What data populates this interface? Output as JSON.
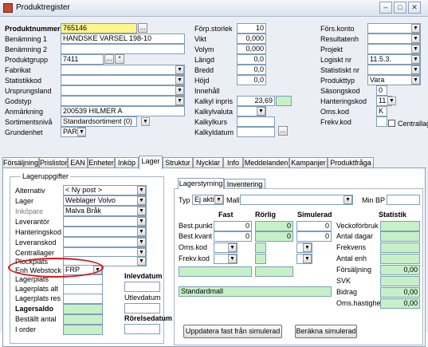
{
  "window": {
    "title": "Produktregister",
    "min": "–",
    "max": "□",
    "close": "✕"
  },
  "header": {
    "produktnummer": {
      "label": "Produktnummer",
      "value": "765146"
    },
    "benamning1": {
      "label": "Benämning 1",
      "value": "HANDSKE VARSEL 198-10"
    },
    "benamning2": {
      "label": "Benämning 2",
      "value": ""
    },
    "produktgrupp": {
      "label": "Produktgrupp",
      "value": "7411"
    },
    "fabrikat": {
      "label": "Fabrikat",
      "value": ""
    },
    "statistikkod": {
      "label": "Statistikkod",
      "value": ""
    },
    "ursprungsland": {
      "label": "Ursprungsland",
      "value": ""
    },
    "godstyp": {
      "label": "Godstyp",
      "value": ""
    },
    "anmarkning": {
      "label": "Anmärkning",
      "value": "200539 HILMER A"
    },
    "sortimentsniva": {
      "label": "Sortimentsnivå",
      "value": "Standardsortiment (0)"
    },
    "grundenhet": {
      "label": "Grundenhet",
      "value": "PAR"
    },
    "forp_storlek": {
      "label": "Förp.storlek",
      "value": "10"
    },
    "vikt": {
      "label": "Vikt",
      "value": "0,000"
    },
    "volym": {
      "label": "Volym",
      "value": "0,000"
    },
    "langd": {
      "label": "Längd",
      "value": "0,0"
    },
    "bredd": {
      "label": "Bredd",
      "value": "0,0"
    },
    "hojd": {
      "label": "Höjd",
      "value": "0,0"
    },
    "innehall": {
      "label": "Innehåll",
      "value": ""
    },
    "kalkyl_inpris": {
      "label": "Kalkyl inpris",
      "value": "23,69"
    },
    "kalkylvaluta": {
      "label": "Kalkylvaluta",
      "value": ""
    },
    "kalkylkurs": {
      "label": "Kalkylkurs",
      "value": ""
    },
    "kalkyldatum": {
      "label": "Kalkyldatum",
      "value": ""
    },
    "fors_konto": {
      "label": "Förs.konto",
      "value": ""
    },
    "resultatenh": {
      "label": "Resultatenh",
      "value": ""
    },
    "projekt": {
      "label": "Projekt",
      "value": ""
    },
    "logiskt_nr": {
      "label": "Logiskt nr",
      "value": "11.5.3."
    },
    "statistiskt_nr": {
      "label": "Statistiskt nr",
      "value": ""
    },
    "produkttyp": {
      "label": "Produkttyp",
      "value": "Vara"
    },
    "sasongskod": {
      "label": "Säsongskod",
      "value": "0"
    },
    "hanteringskod": {
      "label": "Hanteringskod",
      "value": "11"
    },
    "oms_kod": {
      "label": "Oms.kod",
      "value": "K"
    },
    "frekv_kod": {
      "label": "Frekv.kod",
      "value": ""
    },
    "centrallager": {
      "label": "Centrallager"
    }
  },
  "tabs": [
    "Försäljning",
    "Prislistor",
    "EAN",
    "Enheter",
    "Inköp",
    "Lager",
    "Struktur",
    "Nycklar",
    "Info",
    "Meddelanden",
    "Kampanjer",
    "Produktfråga"
  ],
  "lager": {
    "group_title": "Lageruppgifter",
    "alternativ": {
      "label": "Alternativ",
      "value": "< Ny post >"
    },
    "lager": {
      "label": "Lager",
      "value": "Weblager Volvo"
    },
    "inkopare": {
      "label": "Inköpare",
      "value": "Malva Bråk"
    },
    "leverantor": {
      "label": "Leverantör",
      "value": ""
    },
    "hanteringskod": {
      "label": "Hanteringskod",
      "value": ""
    },
    "leveranskod": {
      "label": "Leveranskod",
      "value": ""
    },
    "centrallager": {
      "label": "Centrallager",
      "value": ""
    },
    "plockplats": {
      "label": "Plockplats",
      "value": ""
    },
    "enh_webstock": {
      "label": "Enh Webstock",
      "value": "FRP"
    },
    "lagerplats": {
      "label": "Lagerplats",
      "value": ""
    },
    "lagerplats_alt": {
      "label": "Lagerplats alt",
      "value": ""
    },
    "lagerplats_res": {
      "label": "Lagerplats res",
      "value": ""
    },
    "lagersaldo": {
      "label": "Lagersaldo",
      "value": ""
    },
    "bestallt_antal": {
      "label": "Beställt antal",
      "value": ""
    },
    "i_order": {
      "label": "I order",
      "value": ""
    },
    "inlevdatum": "Inlevdatum",
    "utlevdatum": "Utlevdatum",
    "rorelsedatum": "Rörelsedatum"
  },
  "lagerstyrning": {
    "tabs": [
      "Lagerstyrning",
      "Inventering"
    ],
    "typ_label": "Typ",
    "typ_value": "Ej aktiv",
    "mall_label": "Mall",
    "min_bp_label": "Min BP",
    "col_fast": "Fast",
    "col_rorlig": "Rörlig",
    "col_simulerad": "Simulerad",
    "col_statistik": "Statistik",
    "best_punkt": {
      "label": "Best.punkt",
      "fast": "0",
      "rorlig": "0",
      "simulerad": "0"
    },
    "best_kvant": {
      "label": "Best.kvant",
      "fast": "0",
      "rorlig": "0",
      "simulerad": "0"
    },
    "oms_kod": "Oms.kod",
    "frekv_kod": "Frekv.kod",
    "standardmall": "Standardmall",
    "stats": [
      {
        "label": "Veckoförbruk",
        "value": ""
      },
      {
        "label": "Antal dagar",
        "value": ""
      },
      {
        "label": "Frekvens",
        "value": ""
      },
      {
        "label": "Antal enh",
        "value": ""
      },
      {
        "label": "Försäljning",
        "value": "0,00"
      },
      {
        "label": "SVK",
        "value": ""
      },
      {
        "label": "Bidrag",
        "value": "0,00"
      },
      {
        "label": "Oms.hastighet",
        "value": "0,00"
      }
    ],
    "btn_update": "Uppdatera fast från simulerad",
    "btn_calc": "Beräkna simulerad"
  },
  "icons": {
    "dropdown": "▼",
    "ellipsis": "…",
    "star": "*"
  }
}
